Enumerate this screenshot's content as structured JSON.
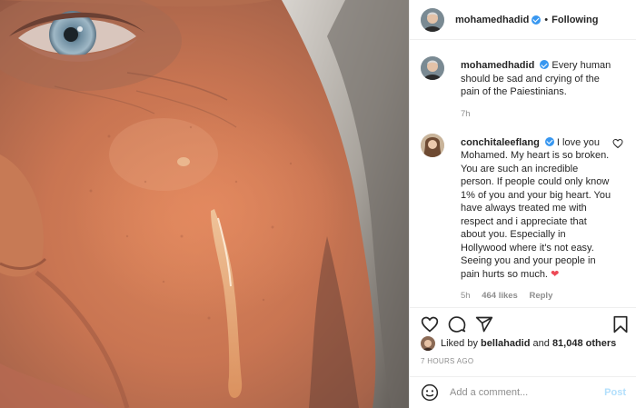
{
  "header": {
    "username": "mohamedhadid",
    "dot": "•",
    "follow_label": "Following"
  },
  "caption": {
    "username": "mohamedhadid",
    "text": "Every human should be sad and crying of the pain of the Paiestinians.",
    "time": "7h"
  },
  "comment": {
    "username": "conchitaleeflang",
    "text": "I love you Mohamed. My heart is so broken. You are such an incredible person. If people could only know 1% of you and your big heart. You have always treated me with respect and i appreciate that about you. Especially in Hollywood where it's not easy. Seeing you and your people in pain hurts so much.",
    "emoji": "❤",
    "time": "5h",
    "likes": "464 likes",
    "reply_label": "Reply"
  },
  "likes_line": {
    "prefix": "Liked by ",
    "user": "bellahadid",
    "middle": " and ",
    "count": "81,048 others"
  },
  "timestamp": "7 HOURS AGO",
  "add_comment": {
    "placeholder": "Add a comment...",
    "post_label": "Post"
  },
  "colors": {
    "verified": "#3897f0",
    "post_disabled": "#b2dffc",
    "heart": "#ed4956"
  },
  "icons": [
    "verified-badge-icon",
    "heart-outline-icon",
    "comment-icon",
    "share-icon",
    "bookmark-icon",
    "emoji-icon",
    "small-heart-icon"
  ]
}
